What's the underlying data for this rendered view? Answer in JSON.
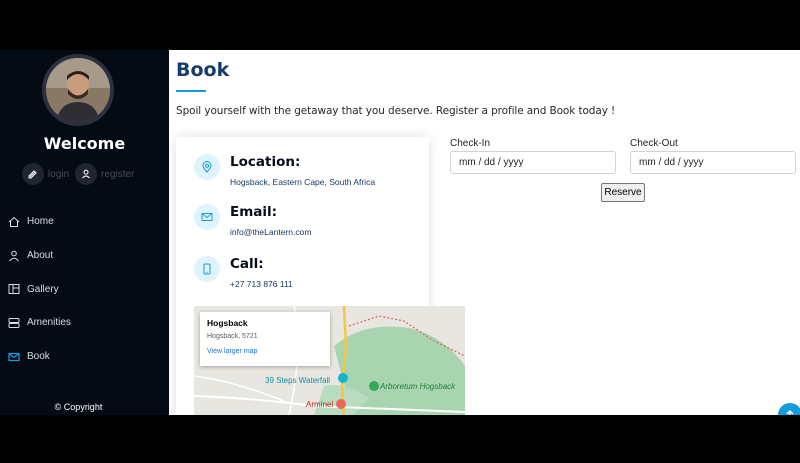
{
  "sidebar": {
    "welcome": "Welcome",
    "auth": {
      "login": "login",
      "register": "register"
    },
    "items": [
      {
        "label": "Home",
        "icon": "home-icon"
      },
      {
        "label": "About",
        "icon": "user-icon"
      },
      {
        "label": "Gallery",
        "icon": "gallery-icon"
      },
      {
        "label": "Amenities",
        "icon": "server-icon"
      },
      {
        "label": "Book",
        "icon": "envelope-icon",
        "active": true
      }
    ],
    "copyright": "© Copyright"
  },
  "main": {
    "title": "Book",
    "intro": "Spoil yourself with the getaway that you deserve. Register a profile and Book today !",
    "info": {
      "location_label": "Location:",
      "location_value": "Hogsback, Eastern Cape, South Africa",
      "email_label": "Email:",
      "email_value": "info@theLantern.com",
      "call_label": "Call:",
      "call_value": "+27 713 876 111"
    },
    "map": {
      "popup_title": "Hogsback",
      "popup_address": "Hogsback, 5721",
      "popup_link": "View larger map",
      "labels": [
        "39 Steps Waterfall",
        "Arboretum Hogsback",
        "Arminel"
      ]
    },
    "form": {
      "checkin_label": "Check-In",
      "checkin_placeholder": "mm / dd / yyyy",
      "checkout_label": "Check-Out",
      "checkout_placeholder": "mm / dd / yyyy",
      "reserve_label": "Reserve"
    }
  },
  "colors": {
    "accent": "#149ddd",
    "sidebar_bg": "#040b14",
    "title": "#173b6c"
  }
}
